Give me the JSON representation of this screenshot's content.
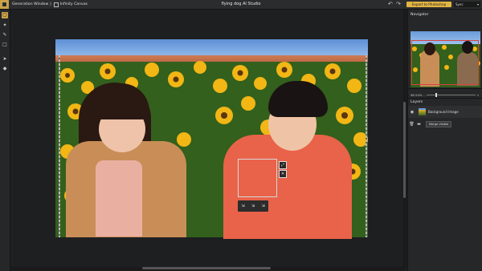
{
  "topbar": {
    "tab1": "Generation Window",
    "separator": "|",
    "tab2": "Infinity Canvas",
    "title": "flying dog AI Studio",
    "undo_icon": "↶",
    "redo_icon": "↷",
    "export_label": "Export to Photoshop",
    "sync_label": "Sync",
    "sync_caret": "▾"
  },
  "tools": {
    "select": "▢",
    "wand": "✦",
    "brush": "✎",
    "marquee": "□",
    "move": "➤",
    "eraser": "◆"
  },
  "canvas": {
    "selection_icon_1": "⤢",
    "selection_icon_2": "✕",
    "mini_toolbar": [
      "⇲",
      "⇲",
      "⇲"
    ]
  },
  "panel": {
    "navigator_title": "Navigator",
    "zoom_value": "98.54%",
    "zoom_minus": "–",
    "zoom_plus": "+",
    "zoom_level": 0.18,
    "layers_title": "Layers",
    "eye_icon": "◉",
    "layer_name": "Background Image",
    "trash_icon": "🗑",
    "folder_icon": "▬",
    "merge_label": "Merge Visible"
  },
  "colors": {
    "accent": "#e2b443",
    "nav_frame": "#d94040",
    "mask": "#e86e5a"
  }
}
